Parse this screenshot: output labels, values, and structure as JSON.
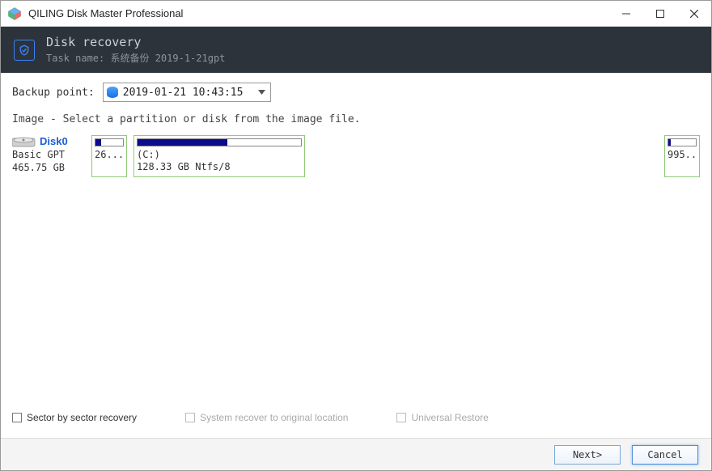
{
  "titlebar": {
    "title": "QILING Disk Master Professional"
  },
  "header": {
    "title": "Disk recovery",
    "subtitle": "Task name: 系统备份 2019-1-21gpt"
  },
  "backup": {
    "label": "Backup point:",
    "selected": "2019-01-21 10:43:15"
  },
  "instruction": "Image - Select a partition or disk from the image file.",
  "disk": {
    "name": "Disk0",
    "type": "Basic GPT",
    "size": "465.75 GB",
    "partitions": [
      {
        "label_line1": "",
        "label_line2": "26...",
        "fill_pct": 22
      },
      {
        "label_line1": "(C:)",
        "label_line2": "128.33 GB Ntfs/8",
        "fill_pct": 55
      },
      {
        "label_line1": "",
        "label_line2": "995...",
        "fill_pct": 10
      }
    ]
  },
  "options": {
    "sector": "Sector by sector recovery",
    "system": "System recover to original location",
    "universal": "Universal Restore"
  },
  "footer": {
    "next": "Next>",
    "cancel": "Cancel"
  }
}
